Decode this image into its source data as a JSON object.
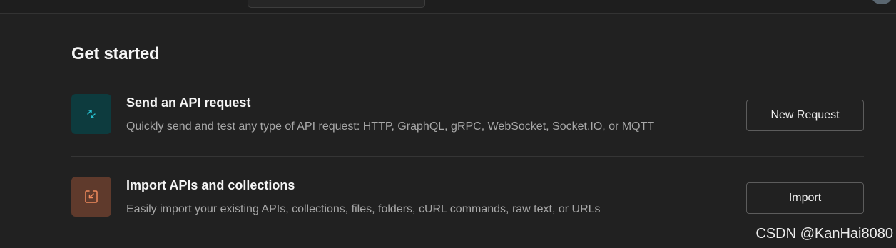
{
  "get_started": {
    "heading": "Get started",
    "items": [
      {
        "title": "Send an API request",
        "description": "Quickly send and test any type of API request: HTTP, GraphQL, gRPC, WebSocket, Socket.IO, or MQTT",
        "button_label": "New Request",
        "icon": "send-arrows-icon",
        "tile_color": "#0d3b3e",
        "icon_color": "#29c5d6"
      },
      {
        "title": "Import APIs and collections",
        "description": "Easily import your existing APIs, collections, files, folders, cURL commands, raw text, or URLs",
        "button_label": "Import",
        "icon": "import-icon",
        "tile_color": "#5f3a2c",
        "icon_color": "#f08a5d"
      }
    ]
  },
  "watermark": "CSDN @KanHai8080",
  "colors": {
    "background": "#212121",
    "title_text": "#f5f5f5",
    "description_text": "#a8a8a8",
    "button_border": "#5c5c5c"
  }
}
